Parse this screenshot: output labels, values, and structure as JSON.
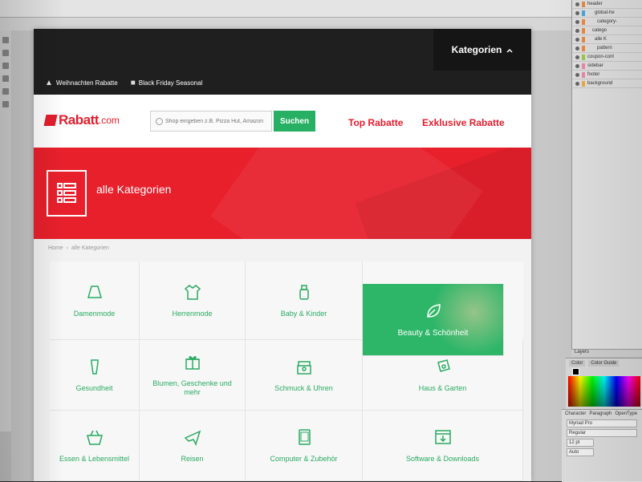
{
  "app": {
    "layers": [
      "header",
      "global-he",
      "category-",
      "catego",
      "alle K",
      "pattern",
      "coupon-cont",
      "sidebar",
      "footer",
      "background"
    ],
    "layers_panel_label": "Layers",
    "color_tabs": [
      "Color",
      "Color Guide"
    ],
    "character_tabs": [
      "Character",
      "Paragraph",
      "OpenType"
    ],
    "font_name": "Myriad Pro",
    "font_style": "Regular",
    "font_size": "12 pt",
    "leading": "Auto"
  },
  "site": {
    "colors": {
      "brand_red": "#e31e2d",
      "accent_green": "#27b063"
    },
    "categories_button": "Kategorien",
    "promo_links": [
      {
        "label": "Weihnachten Rabatte",
        "icon": "tree-icon"
      },
      {
        "label": "Black Friday Seasonal",
        "icon": "gift-icon"
      }
    ],
    "logo": {
      "name": "Rabatt",
      "tld": ".com"
    },
    "search": {
      "placeholder": "Shop eingeben z.B. Pizza Hut, Amazon",
      "button": "Suchen"
    },
    "nav": {
      "top_rabatte": "Top Rabatte",
      "exklusive_rabatte": "Exklusive Rabatte"
    },
    "hero": {
      "title": "alle Kategorien",
      "icon": "list-icon"
    },
    "breadcrumb": [
      "Home",
      "›",
      "alle Kategorien"
    ],
    "categories": [
      {
        "label": "Damenmode",
        "icon": "skirt-icon"
      },
      {
        "label": "Herrenmode",
        "icon": "shirt-icon"
      },
      {
        "label": "Baby & Kinder",
        "icon": "bottle-icon"
      },
      {
        "label": "Beauty & Schönheit",
        "icon": "leaf-icon",
        "active": true
      },
      {
        "label": "Gesundheit",
        "icon": "tube-icon"
      },
      {
        "label": "Blumen, Geschenke und mehr",
        "icon": "gift-icon"
      },
      {
        "label": "Schmuck & Uhren",
        "icon": "ring-box-icon"
      },
      {
        "label": "Haus & Garten",
        "icon": "seed-packet-icon"
      },
      {
        "label": "Essen & Lebensmittel",
        "icon": "basket-icon"
      },
      {
        "label": "Reisen",
        "icon": "plane-icon"
      },
      {
        "label": "Computer & Zubehör",
        "icon": "tablet-icon"
      },
      {
        "label": "Software & Downloads",
        "icon": "download-icon"
      }
    ]
  }
}
